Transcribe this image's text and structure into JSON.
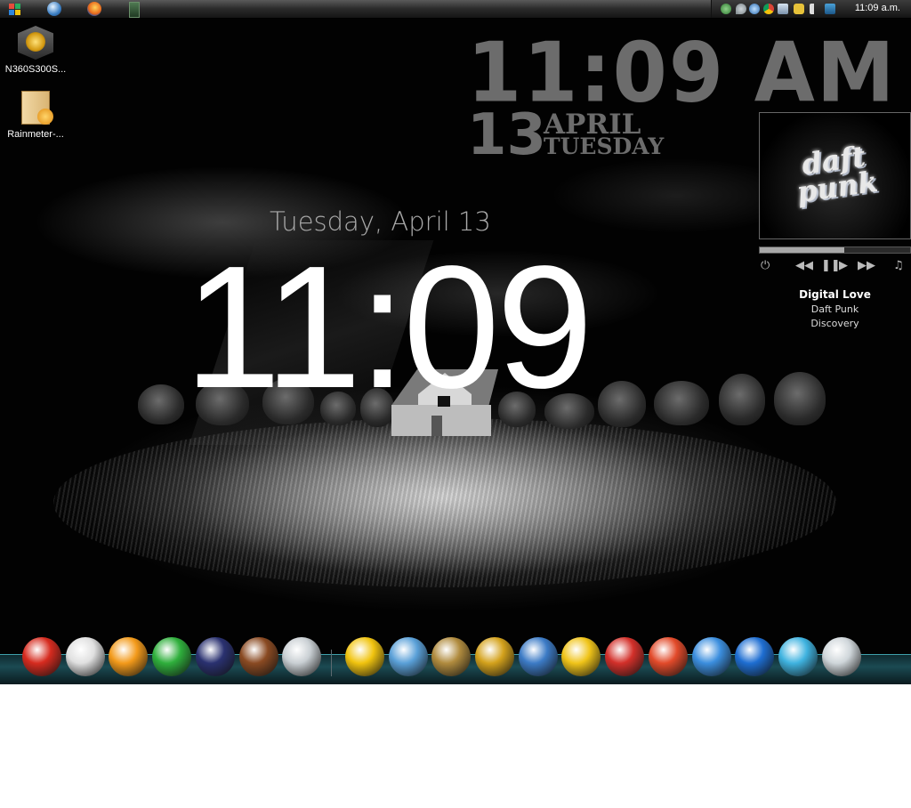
{
  "taskbar": {
    "quick_launch": [
      "start-icon",
      "windows-media-player-icon",
      "firefox-icon",
      "terminal-icon"
    ],
    "tray_icons": [
      "network-icon",
      "droplet-icon",
      "globe-icon",
      "chrome-icon",
      "display-icon",
      "puzzle-icon",
      "volume-icon",
      "media-icon"
    ],
    "clock": "11:09 a.m."
  },
  "desktop_icons": [
    {
      "label": "N360S300S...",
      "icon": "norton-installer-icon"
    },
    {
      "label": "Rainmeter-...",
      "icon": "installer-box-icon"
    }
  ],
  "rainmeter_clock": {
    "time": "11:09 AM",
    "day": "13",
    "month": "APRIL",
    "weekday": "TUESDAY"
  },
  "main_clock": {
    "date": "Tuesday, April 13",
    "time": "11:09"
  },
  "player": {
    "album_art_text": "daft punk",
    "progress": 0.56,
    "title": "Digital Love",
    "artist": "Daft Punk",
    "album": "Discovery",
    "controls": [
      "power-icon",
      "previous-icon",
      "pause-icon",
      "play-icon",
      "next-icon",
      "music-note-icon"
    ]
  },
  "dock": {
    "items": [
      {
        "icon": "mario-icon",
        "color": "#d62b1f"
      },
      {
        "icon": "stormtrooper-icon",
        "color": "#e0e0e0"
      },
      {
        "icon": "fire-flower-icon",
        "color": "#f39a1a"
      },
      {
        "icon": "one-up-mushroom-icon",
        "color": "#2faf3c"
      },
      {
        "icon": "chain-chomp-icon",
        "color": "#2a3170"
      },
      {
        "icon": "goomba-icon",
        "color": "#8a4a22"
      },
      {
        "icon": "recycle-bin-icon",
        "color": "#c9cfd3"
      },
      {
        "icon": "norton-icon",
        "color": "#f1c40f"
      },
      {
        "icon": "itunes-icon",
        "color": "#5aa0d8"
      },
      {
        "icon": "classic-dvd-icon",
        "color": "#b08b3e"
      },
      {
        "icon": "playstation-controller-icon",
        "color": "#d4a21c"
      },
      {
        "icon": "arch-logo-icon",
        "color": "#3c7bc6"
      },
      {
        "icon": "internet-explorer-icon",
        "color": "#f0c419"
      },
      {
        "icon": "winamp-icon",
        "color": "#d3302a"
      },
      {
        "icon": "ccleaner-icon",
        "color": "#e24a2a"
      },
      {
        "icon": "messenger-icon",
        "color": "#3b8ede"
      },
      {
        "icon": "media-player-icon",
        "color": "#1e6ed2"
      },
      {
        "icon": "dvd-player-icon",
        "color": "#3fb3e0"
      },
      {
        "icon": "water-drop-icon",
        "color": "#cfd6da"
      }
    ]
  }
}
